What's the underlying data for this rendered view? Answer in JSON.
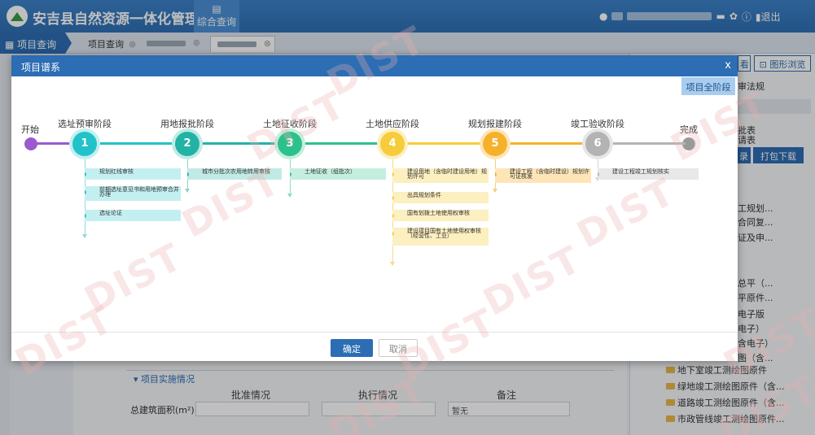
{
  "header": {
    "system_title": "安吉县自然资源一体化管理系统",
    "nav_label": "综合查询",
    "logout": "退出"
  },
  "tabs": {
    "side_label": "项目查询",
    "items": [
      "项目查询"
    ]
  },
  "background": {
    "graph_button": "图形浏览",
    "regulations": "审法规",
    "approval_1": "批表",
    "approval_2": "请表",
    "record_btn": "录",
    "pack_download": "打包下载",
    "list": [
      "工规划...",
      "合同复...",
      "证及申...",
      "总平（...",
      "平原件...",
      "电子版",
      "电子）",
      "含电子）",
      "图（含..."
    ],
    "tree": [
      "地下室竣工测绘图原件",
      "绿地竣工测绘图原件（含...",
      "道路竣工测绘图原件（含...",
      "市政管线竣工测绘图原件..."
    ],
    "section_title": "项目实施情况",
    "col_approval": "批准情况",
    "col_execution": "执行情况",
    "col_remark": "备注",
    "row_label": "总建筑面积(m²)",
    "remark_value": "暂无"
  },
  "modal": {
    "title": "项目谱系",
    "close": "x",
    "all_stages_btn": "项目全阶段",
    "start": "开始",
    "end": "完成",
    "confirm": "确定",
    "cancel": "取消",
    "stages": [
      {
        "num": "1",
        "title": "选址预审阶段",
        "color": "#21c3c9",
        "steps": [
          "规划红线审核",
          "前期选址意见书和用地预审合并办理",
          "选址论证"
        ]
      },
      {
        "num": "2",
        "title": "用地报批阶段",
        "color": "#23b3a5",
        "steps": [
          "城市分批次农用地转用审核"
        ]
      },
      {
        "num": "3",
        "title": "土地征收阶段",
        "color": "#2cc18c",
        "steps": [
          "土地征收（组批次）"
        ]
      },
      {
        "num": "4",
        "title": "土地供应阶段",
        "color": "#f6cc3a",
        "steps": [
          "建设用地（含临时建设用地）规划许可",
          "出具规划条件",
          "国有划拨土地使用权审核",
          "建设项目国有土地使用权审核（经营性、工业）"
        ]
      },
      {
        "num": "5",
        "title": "规划报建阶段",
        "color": "#f6b12b",
        "steps": [
          "建设工程（含临时建设）规划许可证核发"
        ]
      },
      {
        "num": "6",
        "title": "竣工验收阶段",
        "color": "#b3b3b3",
        "steps": [
          "建设工程竣工规划核实"
        ]
      }
    ]
  },
  "watermark": "DIST"
}
